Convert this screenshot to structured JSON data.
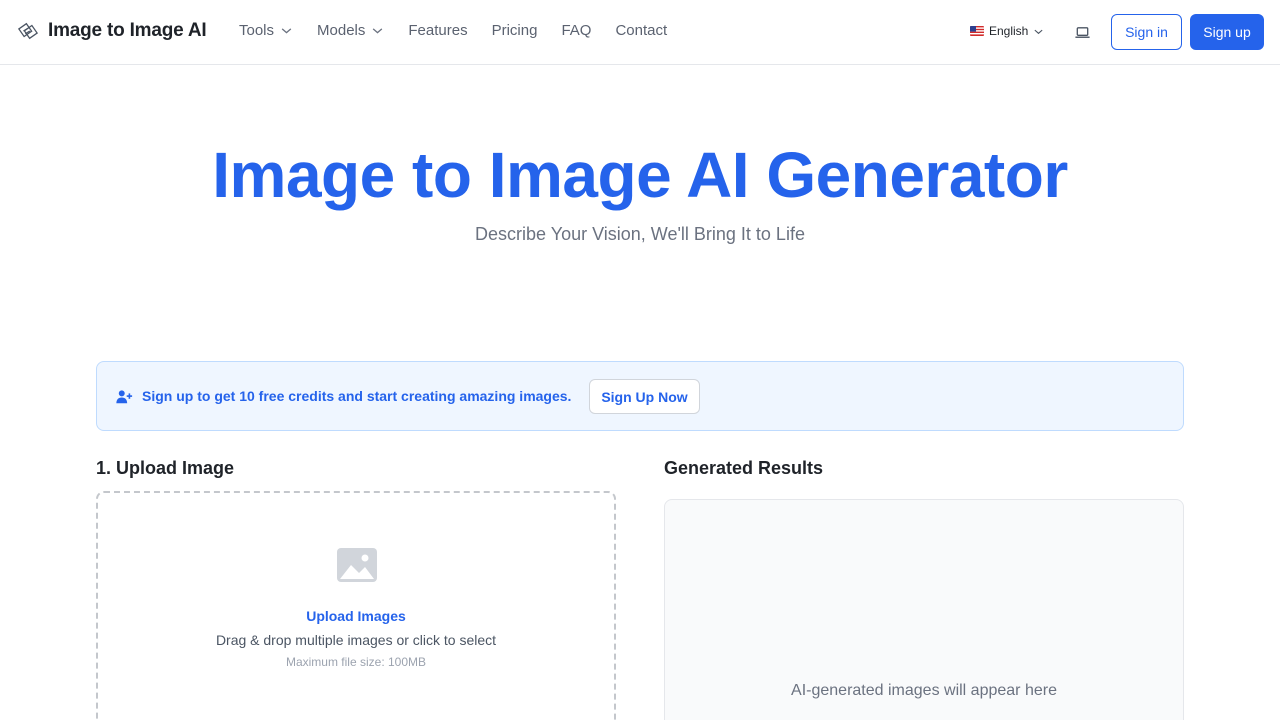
{
  "header": {
    "brand_name": "Image to Image AI",
    "nav": [
      {
        "label": "Tools"
      },
      {
        "label": "Models"
      },
      {
        "label": "Features"
      },
      {
        "label": "Pricing"
      },
      {
        "label": "FAQ"
      },
      {
        "label": "Contact"
      }
    ],
    "language": "English",
    "sign_in": "Sign in",
    "sign_up": "Sign up"
  },
  "hero": {
    "title": "Image to Image AI Generator",
    "subtitle": "Describe Your Vision, We'll Bring It to Life"
  },
  "banner": {
    "text": "Sign up to get 10 free credits and start creating amazing images.",
    "button": "Sign Up Now"
  },
  "upload": {
    "heading": "1. Upload Image",
    "title": "Upload Images",
    "description": "Drag & drop multiple images or click to select",
    "max_size": "Maximum file size: 100MB"
  },
  "results": {
    "heading": "Generated Results",
    "placeholder": "AI-generated images will appear here"
  },
  "colors": {
    "accent": "#2563eb",
    "banner_bg": "#eff6ff",
    "muted_text": "#6b7280"
  }
}
